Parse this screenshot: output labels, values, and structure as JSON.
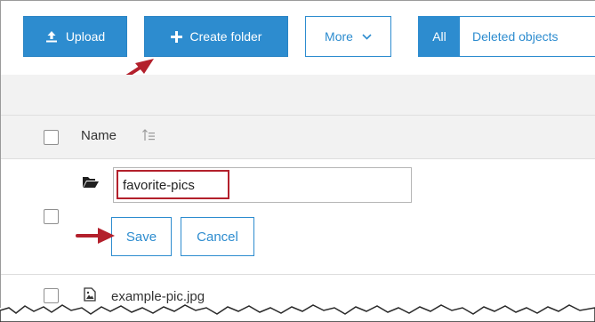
{
  "toolbar": {
    "upload_label": "Upload",
    "create_folder_label": "Create folder",
    "more_label": "More",
    "filter_all_label": "All",
    "filter_deleted_label": "Deleted objects"
  },
  "table": {
    "name_header": "Name"
  },
  "new_folder": {
    "input_value": "favorite-pics",
    "save_label": "Save",
    "cancel_label": "Cancel"
  },
  "files": [
    {
      "name": "example-pic.jpg"
    }
  ],
  "icons": {
    "upload": "upload-icon",
    "create": "plus-icon",
    "more": "chevron-down-icon",
    "sort": "sort-ascending-icon",
    "folder": "folder-open-icon",
    "file": "image-file-icon"
  },
  "colors": {
    "accent": "#2d8ccf",
    "annotation": "#b3202c",
    "row_background": "#f2f2f2"
  }
}
